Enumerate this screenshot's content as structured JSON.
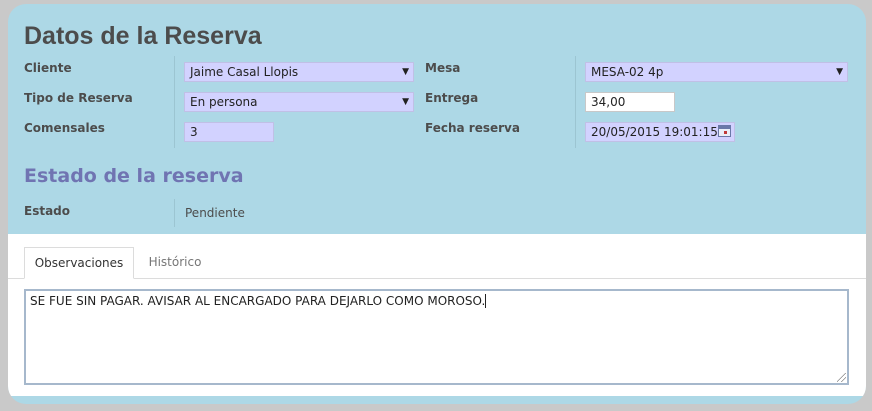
{
  "form": {
    "title": "Datos de la Reserva",
    "cliente": {
      "label": "Cliente",
      "value": "Jaime Casal Llopis"
    },
    "tipo_reserva": {
      "label": "Tipo de Reserva",
      "value": "En persona"
    },
    "comensales": {
      "label": "Comensales",
      "value": "3"
    },
    "mesa": {
      "label": "Mesa",
      "value": "MESA-02 4p"
    },
    "entrega": {
      "label": "Entrega",
      "value": "34,00"
    },
    "fecha_reserva": {
      "label": "Fecha reserva",
      "value": "20/05/2015 19:01:15"
    }
  },
  "estado_section": {
    "title": "Estado de la reserva",
    "estado": {
      "label": "Estado",
      "value": "Pendiente"
    }
  },
  "tabs": [
    {
      "label": "Observaciones",
      "active": true
    },
    {
      "label": "Histórico",
      "active": false
    }
  ],
  "observaciones": "SE FUE SIN PAGAR. AVISAR AL ENCARGADO PARA DEJARLO COMO MOROSO.",
  "icons": {
    "dropdown": "chevron-down-icon",
    "date_picker": "calendar-icon",
    "resize": "resize-handle-icon"
  },
  "colors": {
    "header_bg": "#add8e6",
    "field_bg": "#d2d2ff",
    "section_title": "#7074b2",
    "title": "#4c4c4c"
  }
}
